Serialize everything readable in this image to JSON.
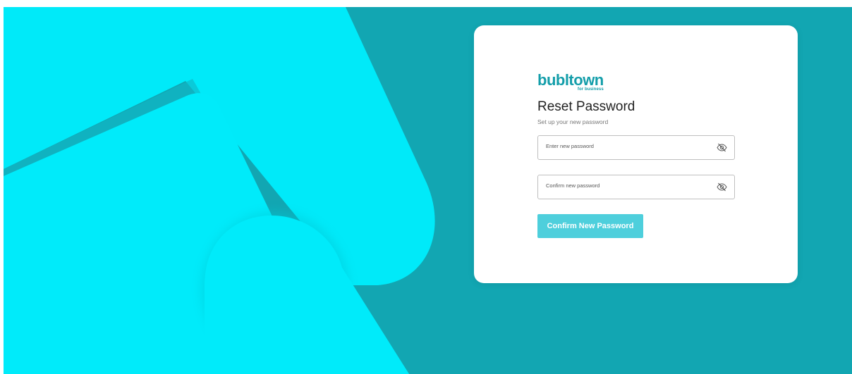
{
  "brand": {
    "name": "bubltown",
    "tagline": "for business",
    "color": "#149eaa"
  },
  "colors": {
    "background": "#12a6b2",
    "accent_shape": "#00e9f8",
    "button": "#4ecfdc"
  },
  "reset": {
    "title": "Reset Password",
    "subtitle": "Set up your new password",
    "new_password": {
      "placeholder": "Enter new password",
      "value": "",
      "icon": "eye-slash-icon"
    },
    "confirm_password": {
      "placeholder": "Confirm new password",
      "value": "",
      "icon": "eye-slash-icon"
    },
    "submit_label": "Confirm New Password"
  }
}
